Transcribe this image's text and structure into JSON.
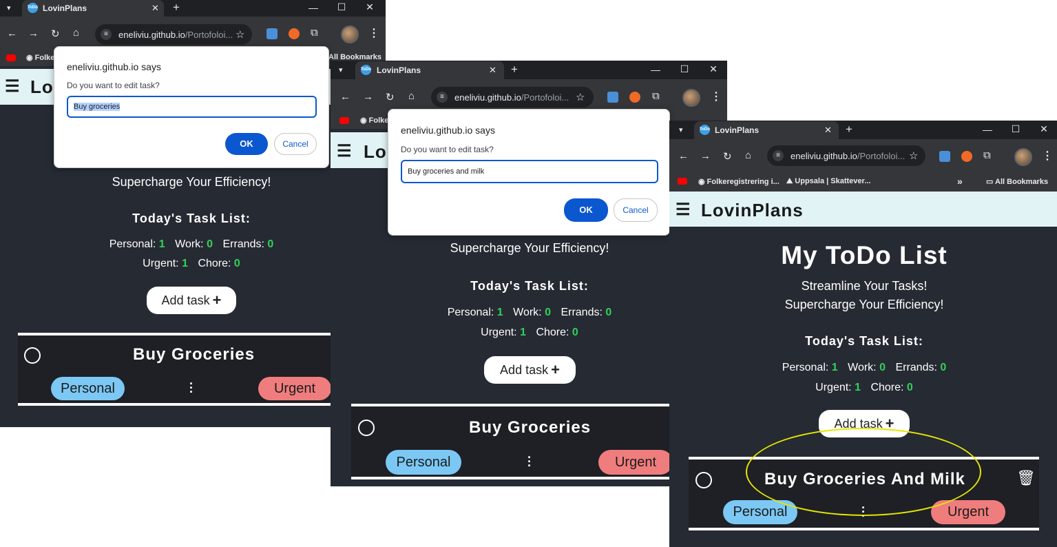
{
  "browser": {
    "tab_title": "LovinPlans",
    "url_host": "eneliviu.github.io",
    "url_path": "/Portofoloi...",
    "bookmarks": {
      "folke_short": "Folke",
      "folke_full": "Folkeregistrering i...",
      "uppsala": "Uppsala | Skattever...",
      "all_bookmarks": "All Bookmarks",
      "more": "»"
    }
  },
  "app": {
    "brand": "LovinPlans",
    "brand_truncated": "Lo",
    "heading": "My ToDo List",
    "tagline1": "Streamline Your Tasks!",
    "tagline2": "Supercharge Your Efficiency!",
    "task_list_title": "Today's Task List:",
    "counts": {
      "personal_label": "Personal:",
      "personal": "1",
      "work_label": "Work:",
      "work": "0",
      "errands_label": "Errands:",
      "errands": "0",
      "urgent_label": "Urgent:",
      "urgent": "1",
      "chore_label": "Chore:",
      "chore": "0"
    },
    "add_task_label": "Add task",
    "tag_personal": "Personal",
    "tag_urgent": "Urgent"
  },
  "windows": [
    {
      "task_title": "Buy Groceries",
      "dialog": {
        "title": "eneliviu.github.io says",
        "message": "Do you want to edit task?",
        "input_value": "Buy groceries",
        "ok_label": "OK",
        "cancel_label": "Cancel"
      }
    },
    {
      "task_title": "Buy Groceries",
      "dialog": {
        "title": "eneliviu.github.io says",
        "message": "Do you want to edit task?",
        "input_value": "Buy groceries and milk",
        "ok_label": "OK",
        "cancel_label": "Cancel"
      }
    },
    {
      "task_title": "Buy Groceries And Milk"
    }
  ],
  "colors": {
    "page_bg": "#262a33",
    "header_bg": "#e1f3f4",
    "count_green": "#2fd25a",
    "personal_tag": "#7cc8f5",
    "urgent_tag": "#f07d7d",
    "dialog_button": "#0b57d0",
    "highlight_ellipse": "#e6e600"
  }
}
